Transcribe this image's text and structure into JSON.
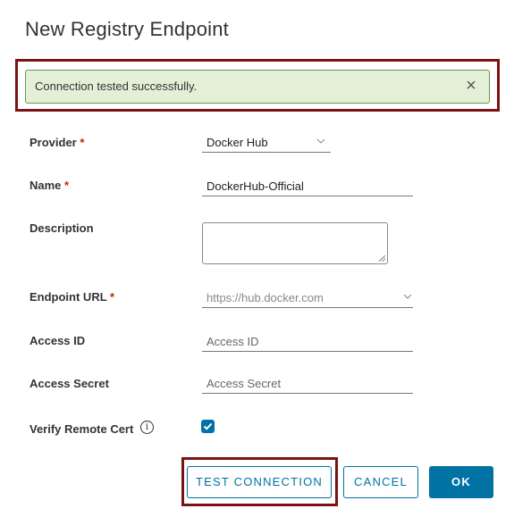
{
  "modal": {
    "title": "New Registry Endpoint"
  },
  "alert": {
    "message": "Connection tested successfully.",
    "close_symbol": "×",
    "status_color": "#e3f0d7"
  },
  "form": {
    "required_marker": "*",
    "provider": {
      "label": "Provider",
      "value": "Docker Hub"
    },
    "name": {
      "label": "Name",
      "value": "DockerHub-Official"
    },
    "description": {
      "label": "Description",
      "value": ""
    },
    "endpoint_url": {
      "label": "Endpoint URL",
      "placeholder": "https://hub.docker.com"
    },
    "access_id": {
      "label": "Access ID",
      "placeholder": "Access ID"
    },
    "access_secret": {
      "label": "Access Secret",
      "placeholder": "Access Secret"
    },
    "verify_remote_cert": {
      "label": "Verify Remote Cert",
      "checked": true,
      "info_glyph": "i"
    }
  },
  "buttons": {
    "test_connection": "TEST CONNECTION",
    "cancel": "CANCEL",
    "ok": "OK"
  },
  "colors": {
    "accent": "#0072a3",
    "highlight": "#7a1414",
    "required": "#c92100"
  }
}
